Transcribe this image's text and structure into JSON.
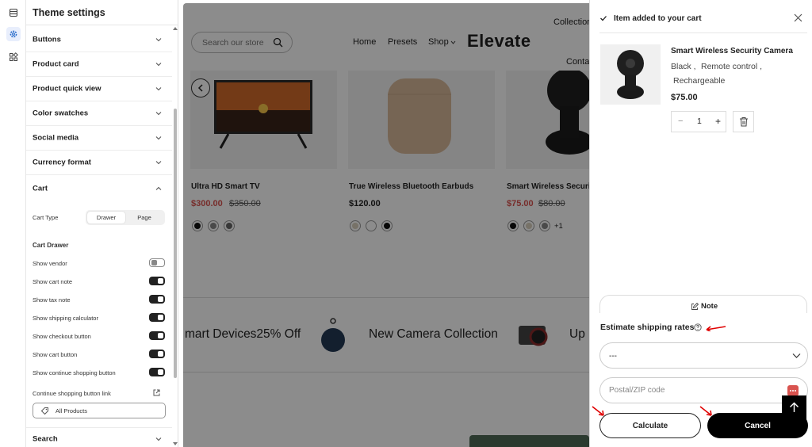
{
  "rail": {
    "icons": [
      "stack-icon",
      "gear-icon",
      "blocks-icon"
    ]
  },
  "panel": {
    "title": "Theme settings",
    "sections_top": [
      "Buttons",
      "Product card",
      "Product quick view",
      "Color swatches",
      "Social media",
      "Currency format"
    ],
    "cart": {
      "title": "Cart",
      "cart_type_label": "Cart Type",
      "cart_type_options": [
        "Drawer",
        "Page"
      ],
      "cart_type_selected": "Drawer",
      "drawer_heading": "Cart Drawer",
      "toggles": [
        {
          "label": "Show vendor",
          "on": false
        },
        {
          "label": "Show cart note",
          "on": true
        },
        {
          "label": "Show tax note",
          "on": true
        },
        {
          "label": "Show shipping calculator",
          "on": true
        },
        {
          "label": "Show checkout button",
          "on": true
        },
        {
          "label": "Show cart button",
          "on": true
        },
        {
          "label": "Show continue shopping button",
          "on": true
        }
      ],
      "link_label": "Continue shopping button link",
      "link_value": "All Products"
    },
    "search_label": "Search"
  },
  "store": {
    "search_placeholder": "Search our store",
    "nav": [
      "Home",
      "Presets",
      "Shop"
    ],
    "nav_right": [
      "Collection",
      "Conta"
    ],
    "logo": "Elevate",
    "products": [
      {
        "name": "Ultra HD Smart TV",
        "price": "$300.00",
        "compare": "$350.00",
        "swatches": [
          "#111111",
          "#888888",
          "#666666"
        ]
      },
      {
        "name": "True Wireless Bluetooth Earbuds",
        "price": "$120.00",
        "compare": "",
        "swatches": [
          "#d9d0bd",
          "#ffffff",
          "#111111"
        ]
      },
      {
        "name": "Smart Wireless Securit",
        "price": "$75.00",
        "compare": "$80.00",
        "swatches": [
          "#111111",
          "#d9d0bd",
          "#888888"
        ],
        "more": "+1"
      }
    ],
    "marquee": [
      "mart Devices25% Off",
      "New Camera Collection",
      "Up"
    ]
  },
  "drawer": {
    "header": "Item added to your cart",
    "item": {
      "title": "Smart Wireless Security Camera",
      "variant_1": "Black ,",
      "variant_2": "Remote control ,",
      "variant_3": "Rechargeable",
      "price": "$75.00",
      "qty": "1",
      "minus": "−",
      "plus": "+"
    },
    "note_label": "Note",
    "shipping_title": "Estimate shipping rates",
    "country_value": "---",
    "zip_placeholder": "Postal/ZIP code",
    "calculate_label": "Calculate",
    "cancel_label": "Cancel"
  },
  "colors": {
    "accent": "#2c6ecb",
    "sale": "#d9534f",
    "annotation": "#e00000"
  }
}
